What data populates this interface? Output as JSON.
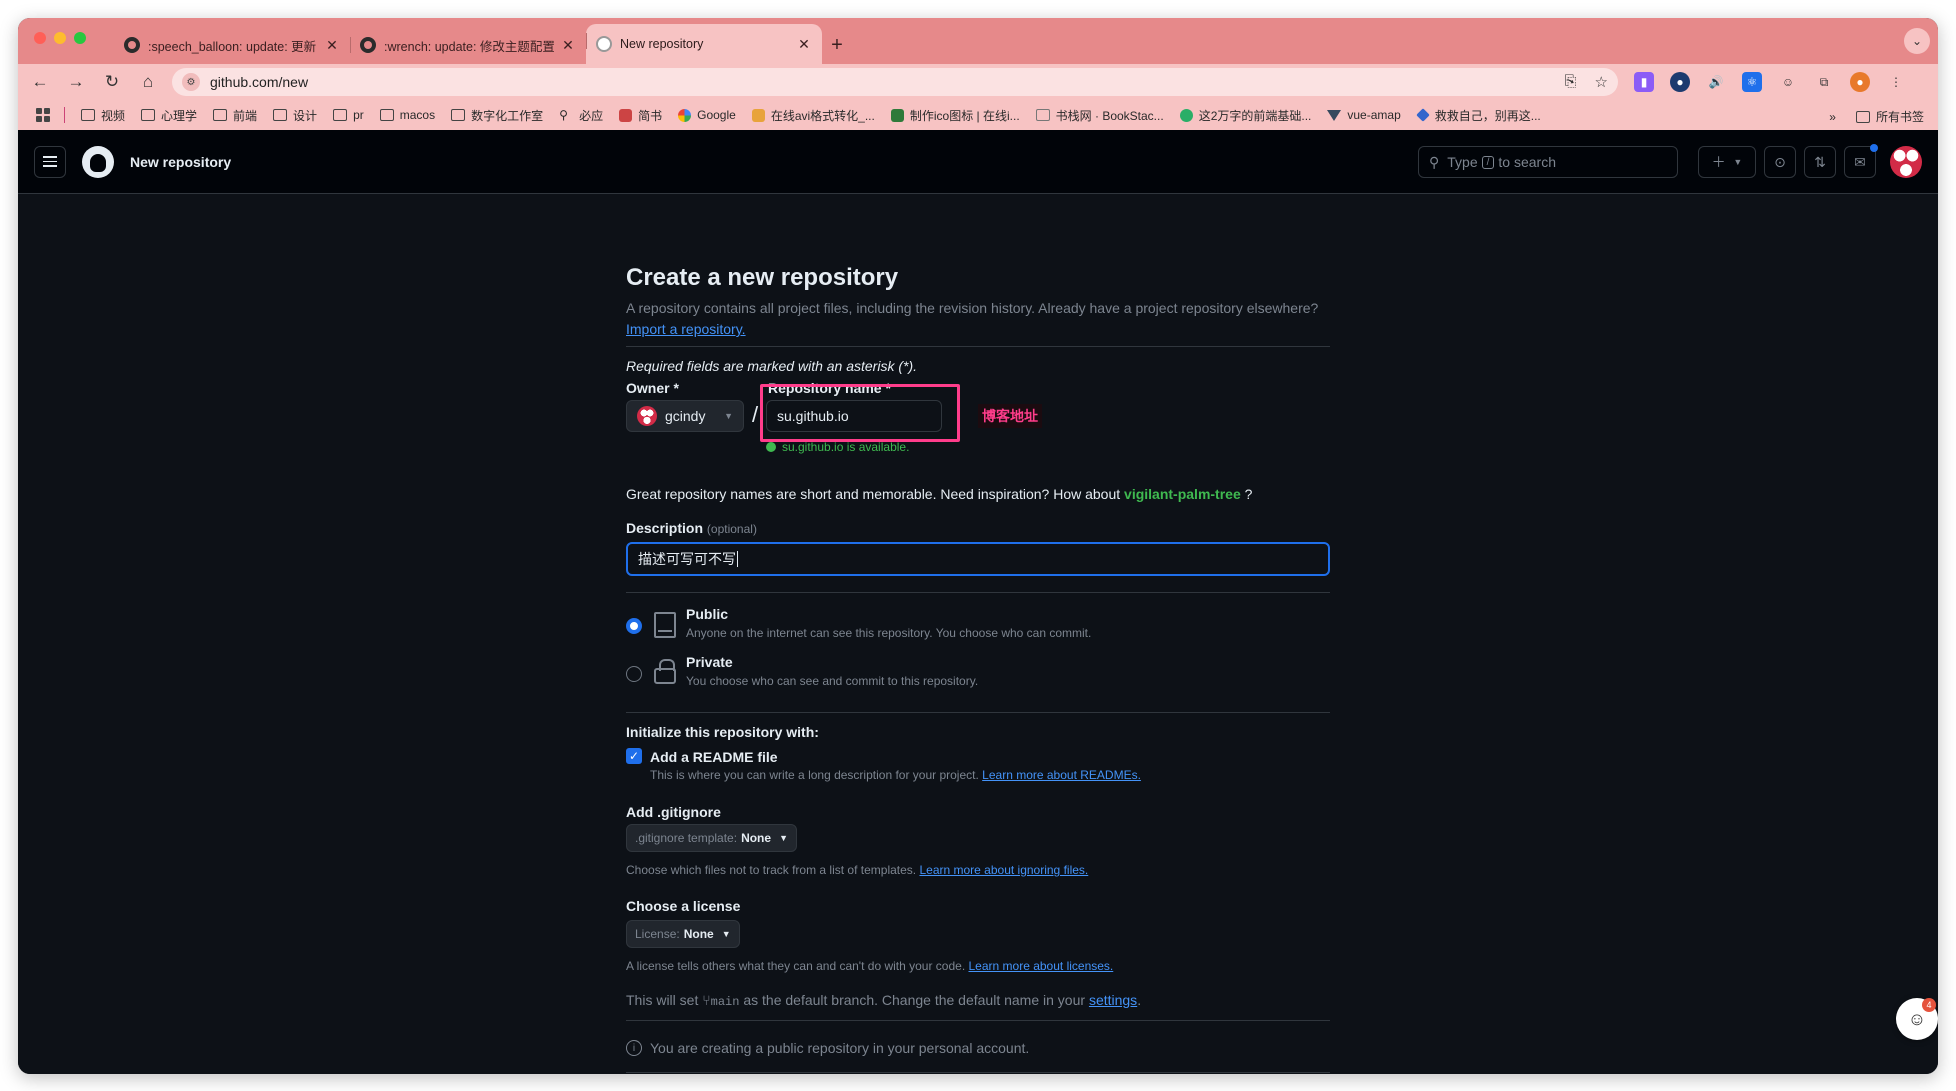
{
  "browser": {
    "tabs": [
      {
        "label": ":speech_balloon: update: 更新"
      },
      {
        "label": ":wrench: update: 修改主题配置"
      },
      {
        "label": "New repository"
      }
    ],
    "url": "github.com/new",
    "bookmarks": [
      {
        "label": "视频",
        "icon": "folder-icon"
      },
      {
        "label": "心理学",
        "icon": "folder-icon"
      },
      {
        "label": "前端",
        "icon": "folder-icon"
      },
      {
        "label": "设计",
        "icon": "folder-icon"
      },
      {
        "label": "pr",
        "icon": "folder-icon"
      },
      {
        "label": "macos",
        "icon": "folder-icon"
      },
      {
        "label": "数字化工作室",
        "icon": "folder-icon"
      },
      {
        "label": "必应",
        "icon": "search-icon"
      },
      {
        "label": "简书",
        "icon": "favicon-icon"
      },
      {
        "label": "Google",
        "icon": "google-icon"
      },
      {
        "label": "在线avi格式转化_...",
        "icon": "favicon-icon"
      },
      {
        "label": "制作ico图标 | 在线i...",
        "icon": "favicon-icon"
      },
      {
        "label": "书栈网 · BookStac...",
        "icon": "doc-icon"
      },
      {
        "label": "这2万字的前端基础...",
        "icon": "wechat-icon"
      },
      {
        "label": "vue-amap",
        "icon": "vue-icon"
      },
      {
        "label": "救救自己，别再这...",
        "icon": "favicon-icon"
      }
    ],
    "all_bookmarks_label": "所有书签"
  },
  "github": {
    "header_title": "New repository",
    "search_prefix": "Type",
    "search_key": "/",
    "search_suffix": "to search"
  },
  "form": {
    "title": "Create a new repository",
    "subtitle": "A repository contains all project files, including the revision history. Already have a project repository elsewhere?",
    "import_link": "Import a repository.",
    "required_note": "Required fields are marked with an asterisk (*).",
    "owner_label": "Owner *",
    "owner_value": "gcindy",
    "repo_label": "Repository name *",
    "repo_value": "su.github.io",
    "repo_available": "su.github.io is available.",
    "annotation": "博客地址",
    "inspire_text": "Great repository names are short and memorable. Need inspiration? How about",
    "suggestion": "vigilant-palm-tree",
    "inspire_end": "?",
    "description_label": "Description",
    "description_optional": "(optional)",
    "description_value": "描述可写可不写",
    "public_title": "Public",
    "public_desc": "Anyone on the internet can see this repository. You choose who can commit.",
    "private_title": "Private",
    "private_desc": "You choose who can see and commit to this repository.",
    "init_label": "Initialize this repository with:",
    "readme_label": "Add a README file",
    "readme_desc": "This is where you can write a long description for your project.",
    "readme_link": "Learn more about READMEs.",
    "gitignore_label": "Add .gitignore",
    "gitignore_dd_prefix": ".gitignore template:",
    "gitignore_dd_value": "None",
    "gitignore_desc": "Choose which files not to track from a list of templates.",
    "gitignore_link": "Learn more about ignoring files.",
    "license_label": "Choose a license",
    "license_dd_prefix": "License:",
    "license_dd_value": "None",
    "license_desc": "A license tells others what they can and can't do with your code.",
    "license_link": "Learn more about licenses.",
    "branch_prefix": "This will set",
    "branch_name": "main",
    "branch_suffix": "as the default branch. Change the default name in your",
    "settings_link": "settings",
    "branch_end": ".",
    "public_notice": "You are creating a public repository in your personal account."
  },
  "floating_badge": "4"
}
